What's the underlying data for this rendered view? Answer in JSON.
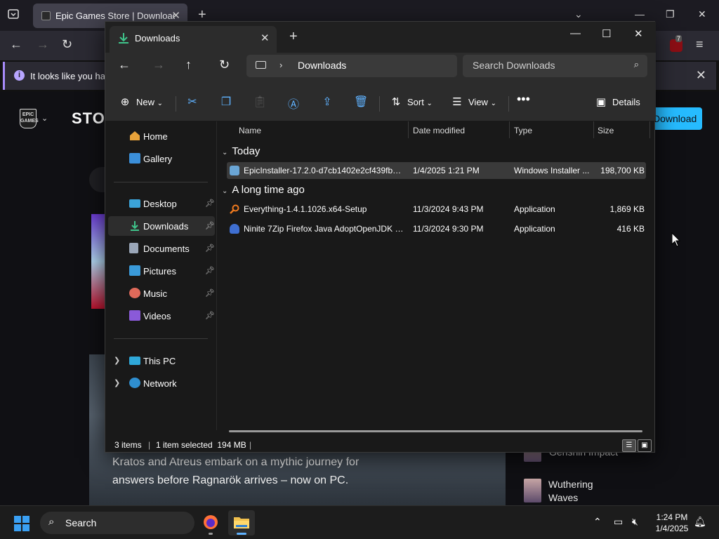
{
  "browser": {
    "tab_title": "Epic Games Store | Download & Play PC Games",
    "infobar_text": "It looks like you have",
    "store_text": "STORE",
    "download_button": "Download",
    "hero_text": "Kratos and Atreus embark on a mythic journey for answers before Ragnarök arrives – now on PC.",
    "side_games": [
      "Genshin Impact",
      "Wuthering Waves"
    ],
    "extension_badge": "7"
  },
  "explorer": {
    "tab_label": "Downloads",
    "breadcrumb": "Downloads",
    "search_placeholder": "Search Downloads",
    "commands": {
      "new": "New",
      "sort": "Sort",
      "view": "View",
      "details": "Details"
    },
    "nav": {
      "home": "Home",
      "gallery": "Gallery",
      "desktop": "Desktop",
      "downloads": "Downloads",
      "documents": "Documents",
      "pictures": "Pictures",
      "music": "Music",
      "videos": "Videos",
      "this_pc": "This PC",
      "network": "Network"
    },
    "columns": {
      "name": "Name",
      "date": "Date modified",
      "type": "Type",
      "size": "Size"
    },
    "groups": {
      "today": "Today",
      "long_ago": "A long time ago"
    },
    "files": [
      {
        "name": "EpicInstaller-17.2.0-d7cb1402e2cf439fb30...",
        "date": "1/4/2025 1:21 PM",
        "type": "Windows Installer ...",
        "size": "198,700 KB"
      },
      {
        "name": "Everything-1.4.1.1026.x64-Setup",
        "date": "11/3/2024 9:43 PM",
        "type": "Application",
        "size": "1,869 KB"
      },
      {
        "name": "Ninite 7Zip Firefox Java AdoptOpenJDK x...",
        "date": "11/3/2024 9:30 PM",
        "type": "Application",
        "size": "416 KB"
      }
    ],
    "status": {
      "items": "3 items",
      "selected": "1 item selected  194 MB"
    }
  },
  "taskbar": {
    "search_placeholder": "Search",
    "time": "1:24 PM",
    "date": "1/4/2025"
  },
  "colors": {
    "accent": "#5fb2ff",
    "epic_blue": "#26bbff",
    "bg": "#191919"
  }
}
